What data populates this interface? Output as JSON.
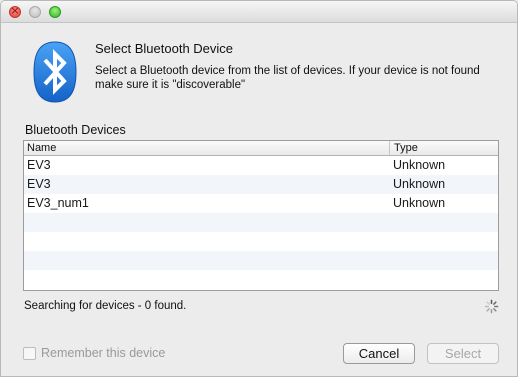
{
  "window": {
    "controls": [
      "close",
      "minimize",
      "zoom"
    ]
  },
  "dialog": {
    "heading": "Select Bluetooth Device",
    "description": "Select a Bluetooth device from the list of devices. If your device is not found make sure it is \"discoverable\"",
    "icon": "bluetooth-icon",
    "accent_color": "#1a7ce0"
  },
  "devices": {
    "section_label": "Bluetooth Devices",
    "columns": [
      "Name",
      "Type"
    ],
    "rows": [
      {
        "name": "EV3",
        "type": "Unknown"
      },
      {
        "name": "EV3",
        "type": "Unknown"
      },
      {
        "name": "EV3_num1",
        "type": "Unknown"
      }
    ]
  },
  "status": {
    "text": "Searching for devices - 0 found."
  },
  "footer": {
    "remember_label": "Remember this device",
    "remember_checked": false,
    "cancel_label": "Cancel",
    "select_label": "Select",
    "select_enabled": false
  }
}
